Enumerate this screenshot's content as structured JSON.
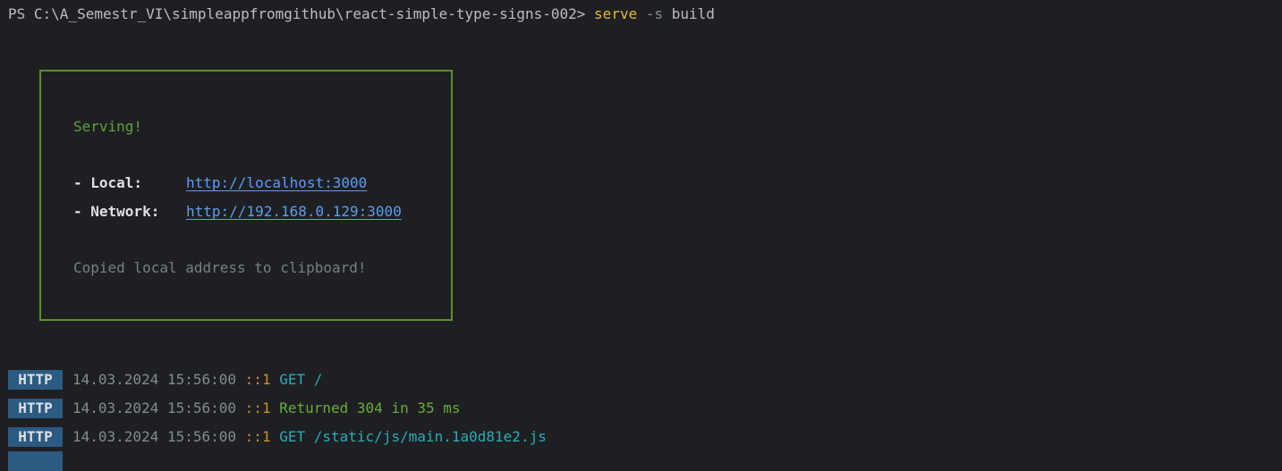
{
  "prompt": {
    "path": "PS C:\\A_Semestr_VI\\simpleappfromgithub\\react-simple-type-signs-002>",
    "command": "serve",
    "flag": "-s",
    "arg": "build"
  },
  "serve_box": {
    "status": "Serving!",
    "local_label": "- Local:",
    "local_url": "http://localhost:3000",
    "network_label": "- Network:",
    "network_url": "http://192.168.0.129:3000",
    "clipboard_note": "Copied local address to clipboard!"
  },
  "logs": [
    {
      "badge": "HTTP",
      "timestamp": "14.03.2024 15:56:00",
      "ip": "::1",
      "message": "GET /"
    },
    {
      "badge": "HTTP",
      "timestamp": "14.03.2024 15:56:00",
      "ip": "::1",
      "message": "Returned 304 in 35 ms"
    },
    {
      "badge": "HTTP",
      "timestamp": "14.03.2024 15:56:00",
      "ip": "::1",
      "message": "GET /static/js/main.1a0d81e2.js"
    }
  ],
  "colors": {
    "background": "#1e1f22",
    "box_border": "#5d8f2c",
    "badge_bg": "#2b5a82",
    "link": "#5c9ef2"
  }
}
